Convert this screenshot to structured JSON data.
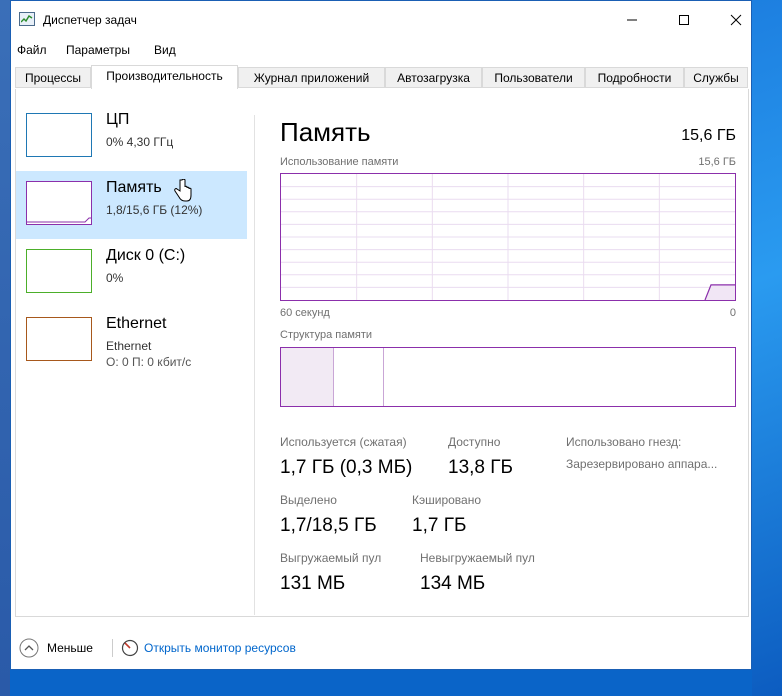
{
  "window": {
    "title": "Диспетчер задач"
  },
  "menu": [
    "Файл",
    "Параметры",
    "Вид"
  ],
  "tabs": [
    "Процессы",
    "Производительность",
    "Журнал приложений",
    "Автозагрузка",
    "Пользователи",
    "Подробности",
    "Службы"
  ],
  "active_tab": "Производительность",
  "sidebar": [
    {
      "title": "ЦП",
      "lines": [
        "0% 4,30 ГГц"
      ],
      "color": "#1f78b4"
    },
    {
      "title": "Память",
      "lines": [
        "1,8/15,6 ГБ (12%)"
      ],
      "color": "#8b2fab"
    },
    {
      "title": "Диск 0 (C:)",
      "lines": [
        "0%"
      ],
      "color": "#4caf2a"
    },
    {
      "title": "Ethernet",
      "lines": [
        "Ethernet",
        "О: 0 П: 0 кбит/с"
      ],
      "color": "#a7581c"
    }
  ],
  "selected_sidebar_index": 1,
  "main": {
    "title": "Память",
    "total": "15,6 ГБ",
    "usage_label": "Использование памяти",
    "usage_max": "15,6 ГБ",
    "time_left": "60 секунд",
    "time_right": "0",
    "composition_label": "Структура памяти",
    "usage_fraction": 0.12
  },
  "stats": {
    "in_use_label": "Используется (сжатая)",
    "in_use_value": "1,7 ГБ (0,3 МБ)",
    "available_label": "Доступно",
    "available_value": "13,8 ГБ",
    "slots_label": "Использовано гнезд:",
    "reserved_label": "Зарезервировано аппара...",
    "committed_label": "Выделено",
    "committed_value": "1,7/18,5 ГБ",
    "cached_label": "Кэшировано",
    "cached_value": "1,7 ГБ",
    "paged_label": "Выгружаемый пул",
    "paged_value": "131 МБ",
    "nonpaged_label": "Невыгружаемый пул",
    "nonpaged_value": "134 МБ"
  },
  "footer": {
    "less_label": "Меньше",
    "monitor_link": "Открыть монитор ресурсов"
  },
  "accent": "#8b2fab",
  "selection_color": "#cce8ff"
}
